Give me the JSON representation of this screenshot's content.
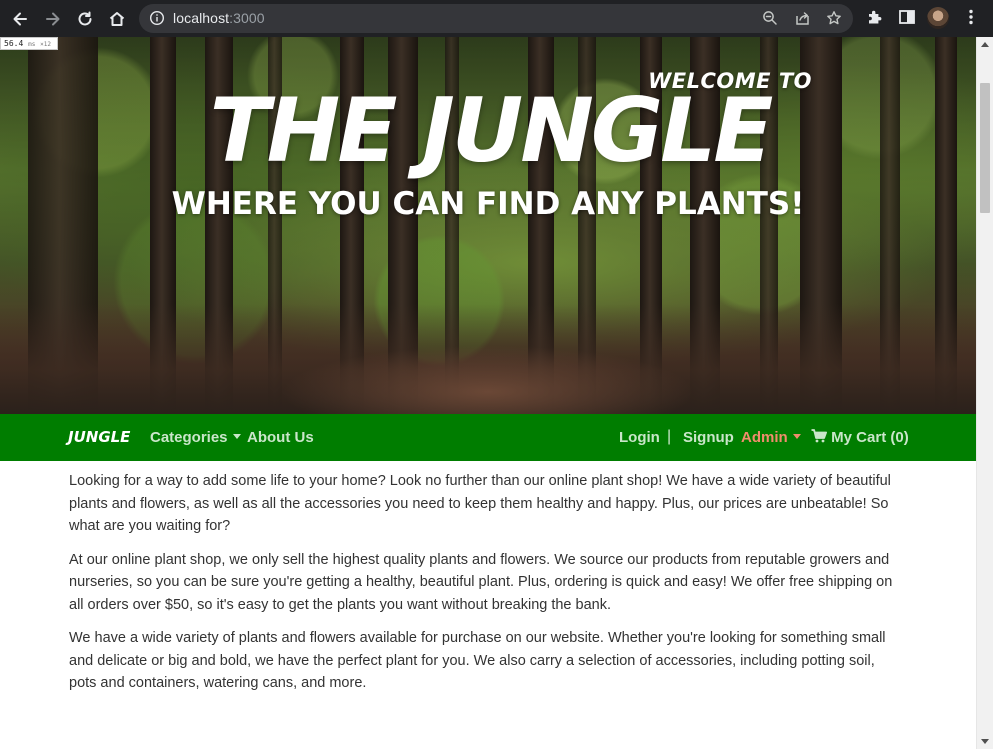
{
  "browser": {
    "url_host": "localhost",
    "url_port": ":3000",
    "fps_value": "56.4",
    "fps_unit": "ms",
    "fps_sub": "×12"
  },
  "hero": {
    "welcome": "WELCOME TO",
    "title": "THE JUNGLE",
    "subtitle": "WHERE YOU CAN FIND ANY PLANTS!"
  },
  "navbar": {
    "brand": "JUNGLE",
    "categories": "Categories",
    "about": "About Us",
    "login": "Login",
    "separator": "|",
    "signup": "Signup",
    "admin": "Admin",
    "cart": "My Cart (0)",
    "colors": {
      "background": "#007d00",
      "link": "#c9e6c9",
      "admin": "#f08d6d"
    }
  },
  "content": {
    "paragraphs": [
      "Looking for a way to add some life to your home? Look no further than our online plant shop! We have a wide variety of beautiful plants and flowers, as well as all the accessories you need to keep them healthy and happy. Plus, our prices are unbeatable! So what are you waiting for?",
      "At our online plant shop, we only sell the highest quality plants and flowers. We source our products from reputable growers and nurseries, so you can be sure you're getting a healthy, beautiful plant. Plus, ordering is quick and easy! We offer free shipping on all orders over $50, so it's easy to get the plants you want without breaking the bank.",
      "We have a wide variety of plants and flowers available for purchase on our website. Whether you're looking for something small and delicate or big and bold, we have the perfect plant for you. We also carry a selection of accessories, including potting soil, pots and containers, watering cans, and more."
    ]
  },
  "icons": [
    "back-icon",
    "forward-icon",
    "reload-icon",
    "home-icon",
    "info-icon",
    "zoom-icon",
    "share-icon",
    "star-icon",
    "extensions-icon",
    "sidepanel-icon",
    "menu-icon",
    "cart-icon"
  ]
}
